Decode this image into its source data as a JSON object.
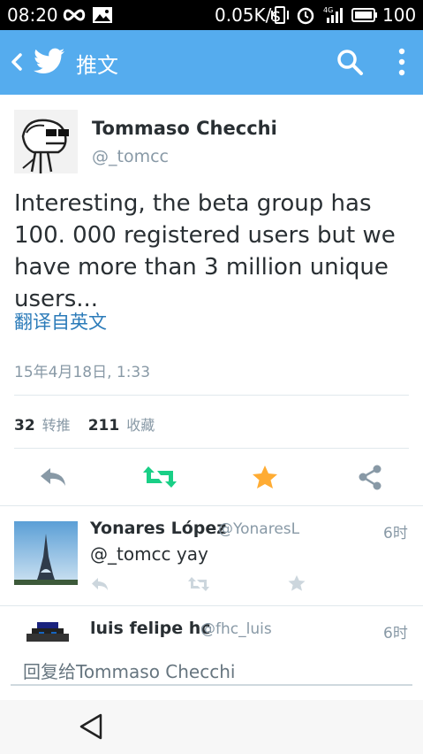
{
  "status_bar": {
    "time": "08:20",
    "network_speed": "0.05K/s",
    "battery": "100",
    "icons": [
      "infinity-icon",
      "image-icon",
      "vibrate-icon",
      "alarm-icon",
      "signal-4g-icon",
      "battery-icon"
    ]
  },
  "action_bar": {
    "title": "推文",
    "color": "#55acee",
    "icons": [
      "back-icon",
      "twitter-bird-icon",
      "search-icon",
      "more-icon"
    ]
  },
  "tweet": {
    "name": "Tommaso Checchi",
    "handle": "@_tomcc",
    "text": "Interesting, the beta group has 100. 000 registered users but we have more than 3 million unique users...",
    "translate": "翻译自英文",
    "timestamp": "15年4月18日, 1:33",
    "retweets_count": "32",
    "retweets_label": "转推",
    "favorites_count": "211",
    "favorites_label": "收藏",
    "actions": [
      "reply-icon",
      "retweet-icon",
      "favorite-icon",
      "share-icon"
    ]
  },
  "replies": [
    {
      "name": "Yonares López",
      "handle": "@YonaresL",
      "time": "6时",
      "text": "@_tomcc yay"
    },
    {
      "name": "luis felipe hc",
      "handle": "@fhc_luis",
      "time": "6时"
    }
  ],
  "compose": {
    "placeholder": "回复给Tommaso Checchi"
  },
  "colors": {
    "accent": "#55acee",
    "retweet_green": "#19cf86",
    "favorite_gold": "#ffac33",
    "link_blue": "#2b7bb9"
  }
}
